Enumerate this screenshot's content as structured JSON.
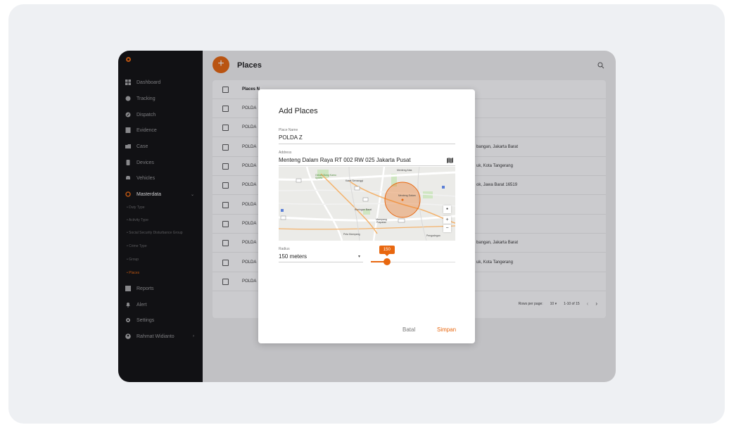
{
  "sidebar": {
    "items": [
      {
        "label": "Dashboard",
        "icon": "dashboard-icon"
      },
      {
        "label": "Tracking",
        "icon": "globe-icon"
      },
      {
        "label": "Dispatch",
        "icon": "compass-icon"
      },
      {
        "label": "Evidence",
        "icon": "document-icon"
      },
      {
        "label": "Case",
        "icon": "folder-icon"
      },
      {
        "label": "Devices",
        "icon": "phone-icon"
      },
      {
        "label": "Vehicles",
        "icon": "car-icon"
      },
      {
        "label": "Masterdata",
        "icon": "ring-icon"
      }
    ],
    "submenu": [
      "Duty Type",
      "Activity Type",
      "Social Security Disturbance Group",
      "Crime Type",
      "Group",
      "Places"
    ],
    "bottom_items": [
      {
        "label": "Reports",
        "icon": "chart-icon"
      },
      {
        "label": "Alert",
        "icon": "bell-icon"
      },
      {
        "label": "Settings",
        "icon": "gear-icon"
      },
      {
        "label": "Rahmat Widianto",
        "icon": "user-icon"
      }
    ],
    "accent_color": "#e8670f"
  },
  "header": {
    "fab_label": "+",
    "title": "Places"
  },
  "table": {
    "header_name": "Places N",
    "rows": [
      {
        "name": "POLDA",
        "address": ""
      },
      {
        "name": "POLDA",
        "address": ""
      },
      {
        "name": "POLDA",
        "address": "bangan, Jakarta Barat"
      },
      {
        "name": "POLDA",
        "address": "uk, Kota Tangerang"
      },
      {
        "name": "POLDA",
        "address": "ok, Jawa Barat 16519"
      },
      {
        "name": "POLDA",
        "address": ""
      },
      {
        "name": "POLDA",
        "address": ""
      },
      {
        "name": "POLDA",
        "address": "bangan, Jakarta Barat"
      },
      {
        "name": "POLDA",
        "address": "uk, Kota Tangerang"
      },
      {
        "name": "POLDA",
        "address": ""
      }
    ],
    "pagination": {
      "rows_per_page_label": "Rows per page:",
      "rows_per_page_value": "10 ▾",
      "range": "1-10 of 15",
      "prev": "‹",
      "next": "›"
    }
  },
  "modal": {
    "title": "Add Places",
    "place_name_label": "Place Name",
    "place_name_value": "POLDA Z",
    "address_label": "Address",
    "address_value": "Menteng Dalam Raya RT 002 RW 025 Jakarta Pusat",
    "map_labels": {
      "menteng_atas": "Menteng Atas",
      "karet_semanggi": "Karet Semanggi",
      "gelora": "Gelora Bung Karno Sports",
      "menteng_dalam": "Menteng Dalam",
      "kuningan_barat": "Kuningan Barat",
      "mampang": "Mampang Prapatan",
      "pela_mampang": "Pela Mampang",
      "pengadegan": "Pengadegan"
    },
    "map_controls": {
      "zoom_in": "+",
      "zoom_out": "−",
      "view": "●"
    },
    "radius_label": "Radius",
    "radius_value": "150 meters",
    "radius_arrow": "▾",
    "slider_value": "150",
    "slider_fraction": 0.19,
    "cancel_label": "Batal",
    "save_label": "Simpan"
  }
}
